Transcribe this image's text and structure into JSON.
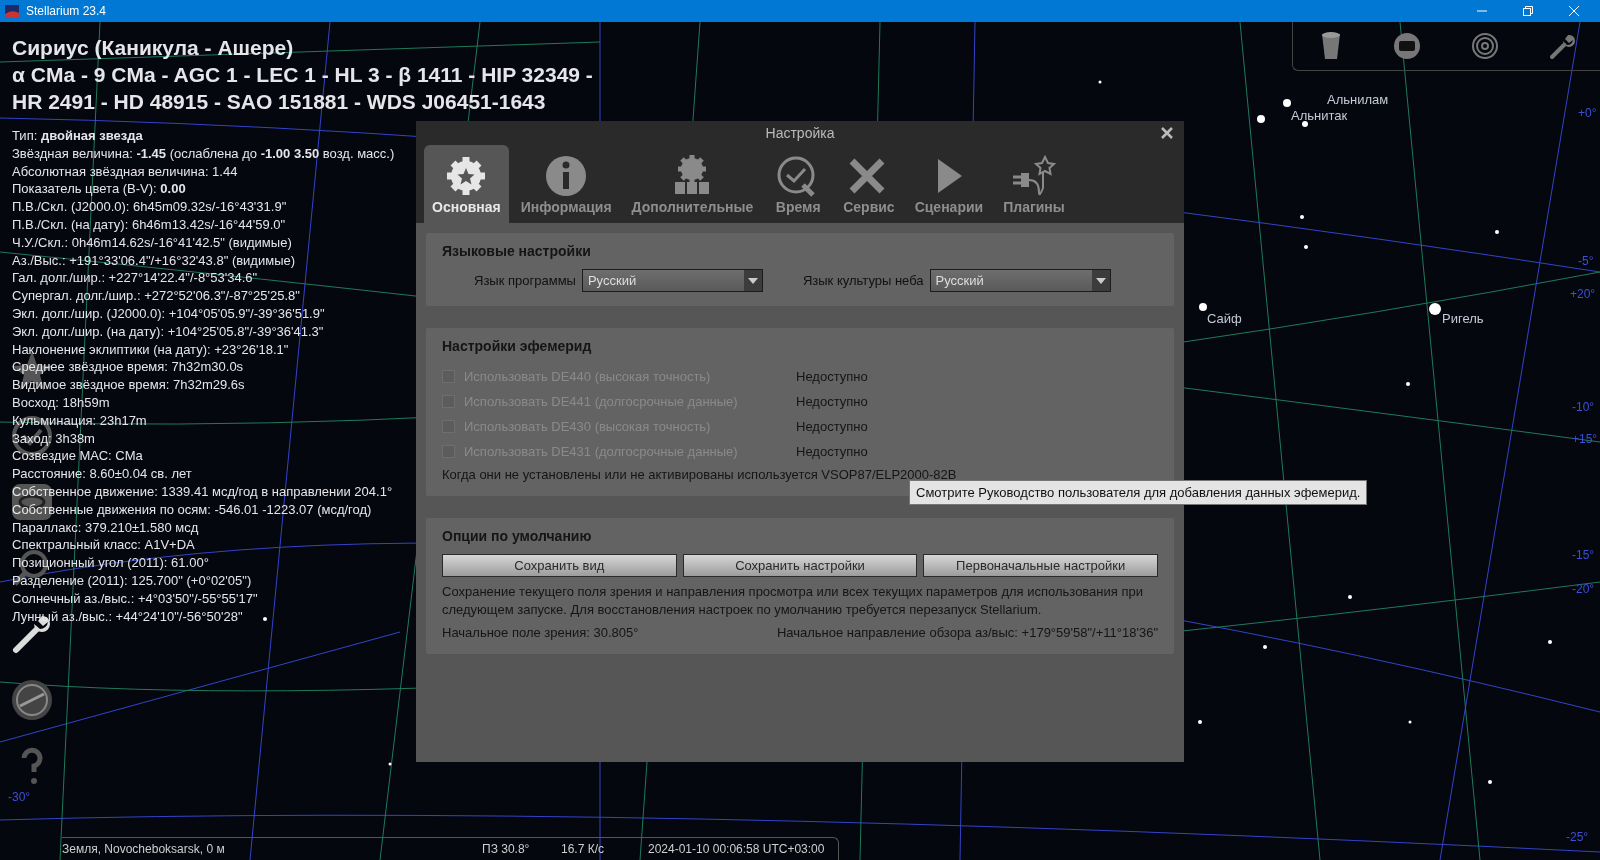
{
  "window": {
    "title": "Stellarium 23.4"
  },
  "object_info": {
    "title_lines": [
      "Сириус (Каникула - Ашере)",
      "α CMa - 9 CMa - AGC 1 - LEC 1 - HL 3 - β 1411 - HIP 32349 -",
      "HR 2491 - HD 48915 - SAO 151881 - WDS J06451-1643"
    ],
    "lines": [
      "Тип: **двойная звезда**",
      "Звёздная величина: **-1.45** (ослаблена до **-1.00 3.50** возд. масс.)",
      "Абсолютная звёздная величина: 1.44",
      "Показатель цвета (B-V): **0.00**",
      "П.В./Скл. (J2000.0): 6h45m09.32s/-16°43'31.9\"",
      "П.В./Скл. (на дату): 6h46m13.42s/-16°44'59.0\"",
      "Ч.У./Скл.: 0h46m14.62s/-16°41'42.5\" (видимые)",
      "Аз./Выс.: +191°33'06.4\"/+16°32'43.8\" (видимые)",
      "Гал. долг./шир.: +227°14'22.4\"/-8°53'34.6\"",
      "Супергал. долг./шир.: +272°52'06.3\"/-87°25'25.8\"",
      "Экл. долг./шир. (J2000.0): +104°05'05.9\"/-39°36'51.9\"",
      "Экл. долг./шир. (на дату): +104°25'05.8\"/-39°36'41.3\"",
      "Наклонение эклиптики (на дату): +23°26'18.1\"",
      "Среднее звёздное время: 7h32m30.0s",
      "Видимое звёздное время: 7h32m29.6s",
      "Восход: 18h59m",
      "Кульминация: 23h17m",
      "Заход: 3h38m",
      "Созвездие МАС: CMa",
      "Расстояние: 8.60±0.04 св. лет",
      "Собственное движение: 1339.41 мсд/год в направлении 204.1°",
      "Собственные движения по осям: -546.01 -1223.07 (мсд/год)",
      "Параллакс: 379.210±1.580 мсд",
      "Спектральный класс: A1V+DA",
      "Позиционный угол (2011): 61.00°",
      "Разделение (2011): 125.700\" (+0°02'05\")",
      "Солнечный аз./выс.: +4°03'50\"/-55°55'17\"",
      "Лунный аз./выс.: +44°24'10\"/-56°50'28\""
    ]
  },
  "sky_labels": [
    "Альнилам",
    "Альнитак",
    "Сайф",
    "Ригель"
  ],
  "grid_labels": [
    "+0°",
    "-5°",
    "+20°",
    "-10°",
    "+15°",
    "-15°",
    "-20°",
    "-25°",
    "-30°"
  ],
  "dialog": {
    "title": "Настройка",
    "tabs": [
      {
        "label": "Основная",
        "selected": true
      },
      {
        "label": "Информация",
        "selected": false
      },
      {
        "label": "Дополнительные",
        "selected": false
      },
      {
        "label": "Время",
        "selected": false
      },
      {
        "label": "Сервис",
        "selected": false
      },
      {
        "label": "Сценарии",
        "selected": false
      },
      {
        "label": "Плагины",
        "selected": false
      }
    ],
    "language": {
      "heading": "Языковые настройки",
      "fields": [
        {
          "label": "Язык программы",
          "value": "Русский"
        },
        {
          "label": "Язык культуры неба",
          "value": "Русский"
        }
      ]
    },
    "ephemeris": {
      "heading": "Настройки эфемерид",
      "options": [
        {
          "label": "Использовать DE440 (высокая точность)",
          "checked": false,
          "disabled": true,
          "status": "Недоступно"
        },
        {
          "label": "Использовать DE441 (долгосрочные данные)",
          "checked": false,
          "disabled": true,
          "status": "Недоступно"
        },
        {
          "label": "Использовать DE430 (высокая точность)",
          "checked": false,
          "disabled": true,
          "status": "Недоступно"
        },
        {
          "label": "Использовать DE431 (долгосрочные данные)",
          "checked": false,
          "disabled": true,
          "status": "Недоступно"
        }
      ],
      "note": "Когда они не установлены или не активированы используется VSOP87/ELP2000-82B"
    },
    "defaults": {
      "heading": "Опции по умолчанию",
      "buttons": [
        "Сохранить вид",
        "Сохранить настройки",
        "Первоначальные настройки"
      ],
      "description": "Сохранение текущего поля зрения и направления просмотра или всех текущих параметров для использования при следующем запуске. Для восстановления настроек по умолчанию требуется перезапуск Stellarium.",
      "fov": "Начальное поле зрения: 30.805°",
      "direction": "Начальное направление обзора аз/выс: +179°59'58\"/+11°18'36\""
    }
  },
  "tooltip": "Смотрите Руководство пользователя для добавления данных эфемерид.",
  "status_bar": {
    "location": "Земля, Novocheboksarsk, 0 м",
    "fov": "ПЗ 30.8°",
    "fps": "16.7 К/с",
    "datetime": "2024-01-10 00:06:58 UTC+03:00"
  }
}
